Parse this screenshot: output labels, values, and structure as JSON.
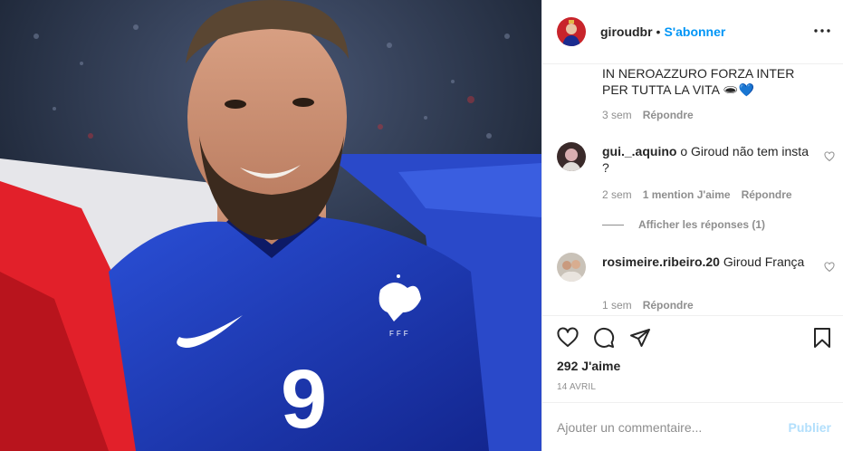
{
  "post": {
    "username": "giroudbr",
    "separator": "•",
    "follow_label": "S'abonner",
    "more_icon": "more-horizontal-icon"
  },
  "comments": [
    {
      "username": "",
      "text": "IN NEROAZZURO FORZA INTER PER TUTTA LA VITA",
      "emoji": "🕳💙",
      "time": "3 sem",
      "reply_label": "Répondre"
    },
    {
      "username": "gui._.aquino",
      "text": "o Giroud não tem insta ?",
      "time": "2 sem",
      "likes_label": "1 mention J'aime",
      "reply_label": "Répondre",
      "view_replies": "Afficher les réponses (1)"
    },
    {
      "username": "rosimeire.ribeiro.20",
      "text": "Giroud França",
      "time": "1 sem",
      "reply_label": "Répondre"
    }
  ],
  "actions": {
    "likes": "292 J'aime",
    "date": "14 AVRIL"
  },
  "add_comment": {
    "placeholder": "Ajouter un commentaire...",
    "publish_label": "Publier"
  },
  "photo": {
    "jersey_number": "9",
    "crest_text": "FFF"
  },
  "colors": {
    "accent": "#0095f6",
    "publish_disabled": "#b2dffc",
    "jersey_blue": "#1e3fb8",
    "flag_red": "#e2202a"
  }
}
